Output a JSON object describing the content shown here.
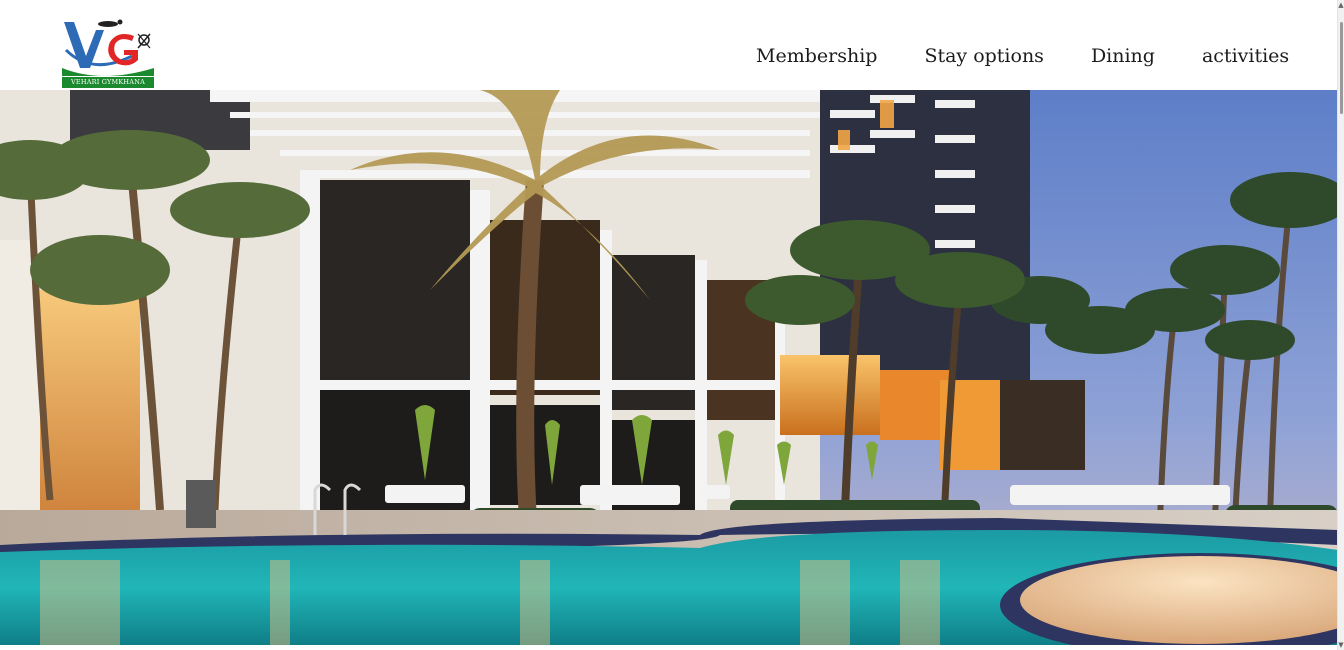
{
  "brand": {
    "logo_text": "VEHARI GYMKHANA",
    "logo_initials": "VG",
    "colors": {
      "blue": "#2e6bb6",
      "red": "#e02626",
      "green": "#1b8a2e"
    }
  },
  "nav": {
    "items": [
      {
        "label": "Membership"
      },
      {
        "label": "Stay options"
      },
      {
        "label": "Dining"
      },
      {
        "label": "activities"
      }
    ]
  },
  "hero": {
    "icon": "hero-resort-pool-image",
    "colors": {
      "sky": "#6f86c2",
      "pool": "#1fb0b5",
      "warm_light": "#f5a43a"
    }
  }
}
